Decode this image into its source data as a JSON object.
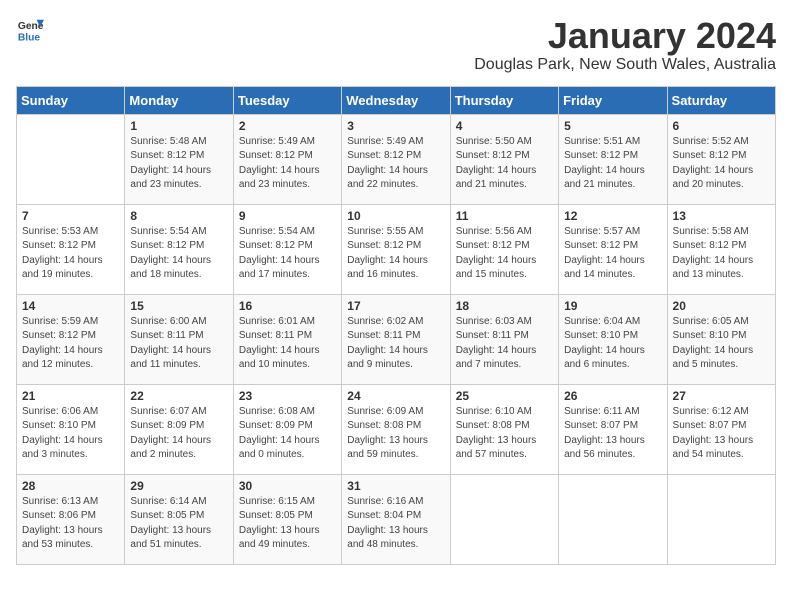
{
  "logo": {
    "general": "General",
    "blue": "Blue"
  },
  "title": "January 2024",
  "subtitle": "Douglas Park, New South Wales, Australia",
  "days_of_week": [
    "Sunday",
    "Monday",
    "Tuesday",
    "Wednesday",
    "Thursday",
    "Friday",
    "Saturday"
  ],
  "weeks": [
    [
      {
        "day": "",
        "info": ""
      },
      {
        "day": "1",
        "info": "Sunrise: 5:48 AM\nSunset: 8:12 PM\nDaylight: 14 hours\nand 23 minutes."
      },
      {
        "day": "2",
        "info": "Sunrise: 5:49 AM\nSunset: 8:12 PM\nDaylight: 14 hours\nand 23 minutes."
      },
      {
        "day": "3",
        "info": "Sunrise: 5:49 AM\nSunset: 8:12 PM\nDaylight: 14 hours\nand 22 minutes."
      },
      {
        "day": "4",
        "info": "Sunrise: 5:50 AM\nSunset: 8:12 PM\nDaylight: 14 hours\nand 21 minutes."
      },
      {
        "day": "5",
        "info": "Sunrise: 5:51 AM\nSunset: 8:12 PM\nDaylight: 14 hours\nand 21 minutes."
      },
      {
        "day": "6",
        "info": "Sunrise: 5:52 AM\nSunset: 8:12 PM\nDaylight: 14 hours\nand 20 minutes."
      }
    ],
    [
      {
        "day": "7",
        "info": "Sunrise: 5:53 AM\nSunset: 8:12 PM\nDaylight: 14 hours\nand 19 minutes."
      },
      {
        "day": "8",
        "info": "Sunrise: 5:54 AM\nSunset: 8:12 PM\nDaylight: 14 hours\nand 18 minutes."
      },
      {
        "day": "9",
        "info": "Sunrise: 5:54 AM\nSunset: 8:12 PM\nDaylight: 14 hours\nand 17 minutes."
      },
      {
        "day": "10",
        "info": "Sunrise: 5:55 AM\nSunset: 8:12 PM\nDaylight: 14 hours\nand 16 minutes."
      },
      {
        "day": "11",
        "info": "Sunrise: 5:56 AM\nSunset: 8:12 PM\nDaylight: 14 hours\nand 15 minutes."
      },
      {
        "day": "12",
        "info": "Sunrise: 5:57 AM\nSunset: 8:12 PM\nDaylight: 14 hours\nand 14 minutes."
      },
      {
        "day": "13",
        "info": "Sunrise: 5:58 AM\nSunset: 8:12 PM\nDaylight: 14 hours\nand 13 minutes."
      }
    ],
    [
      {
        "day": "14",
        "info": "Sunrise: 5:59 AM\nSunset: 8:12 PM\nDaylight: 14 hours\nand 12 minutes."
      },
      {
        "day": "15",
        "info": "Sunrise: 6:00 AM\nSunset: 8:11 PM\nDaylight: 14 hours\nand 11 minutes."
      },
      {
        "day": "16",
        "info": "Sunrise: 6:01 AM\nSunset: 8:11 PM\nDaylight: 14 hours\nand 10 minutes."
      },
      {
        "day": "17",
        "info": "Sunrise: 6:02 AM\nSunset: 8:11 PM\nDaylight: 14 hours\nand 9 minutes."
      },
      {
        "day": "18",
        "info": "Sunrise: 6:03 AM\nSunset: 8:11 PM\nDaylight: 14 hours\nand 7 minutes."
      },
      {
        "day": "19",
        "info": "Sunrise: 6:04 AM\nSunset: 8:10 PM\nDaylight: 14 hours\nand 6 minutes."
      },
      {
        "day": "20",
        "info": "Sunrise: 6:05 AM\nSunset: 8:10 PM\nDaylight: 14 hours\nand 5 minutes."
      }
    ],
    [
      {
        "day": "21",
        "info": "Sunrise: 6:06 AM\nSunset: 8:10 PM\nDaylight: 14 hours\nand 3 minutes."
      },
      {
        "day": "22",
        "info": "Sunrise: 6:07 AM\nSunset: 8:09 PM\nDaylight: 14 hours\nand 2 minutes."
      },
      {
        "day": "23",
        "info": "Sunrise: 6:08 AM\nSunset: 8:09 PM\nDaylight: 14 hours\nand 0 minutes."
      },
      {
        "day": "24",
        "info": "Sunrise: 6:09 AM\nSunset: 8:08 PM\nDaylight: 13 hours\nand 59 minutes."
      },
      {
        "day": "25",
        "info": "Sunrise: 6:10 AM\nSunset: 8:08 PM\nDaylight: 13 hours\nand 57 minutes."
      },
      {
        "day": "26",
        "info": "Sunrise: 6:11 AM\nSunset: 8:07 PM\nDaylight: 13 hours\nand 56 minutes."
      },
      {
        "day": "27",
        "info": "Sunrise: 6:12 AM\nSunset: 8:07 PM\nDaylight: 13 hours\nand 54 minutes."
      }
    ],
    [
      {
        "day": "28",
        "info": "Sunrise: 6:13 AM\nSunset: 8:06 PM\nDaylight: 13 hours\nand 53 minutes."
      },
      {
        "day": "29",
        "info": "Sunrise: 6:14 AM\nSunset: 8:05 PM\nDaylight: 13 hours\nand 51 minutes."
      },
      {
        "day": "30",
        "info": "Sunrise: 6:15 AM\nSunset: 8:05 PM\nDaylight: 13 hours\nand 49 minutes."
      },
      {
        "day": "31",
        "info": "Sunrise: 6:16 AM\nSunset: 8:04 PM\nDaylight: 13 hours\nand 48 minutes."
      },
      {
        "day": "",
        "info": ""
      },
      {
        "day": "",
        "info": ""
      },
      {
        "day": "",
        "info": ""
      }
    ]
  ]
}
